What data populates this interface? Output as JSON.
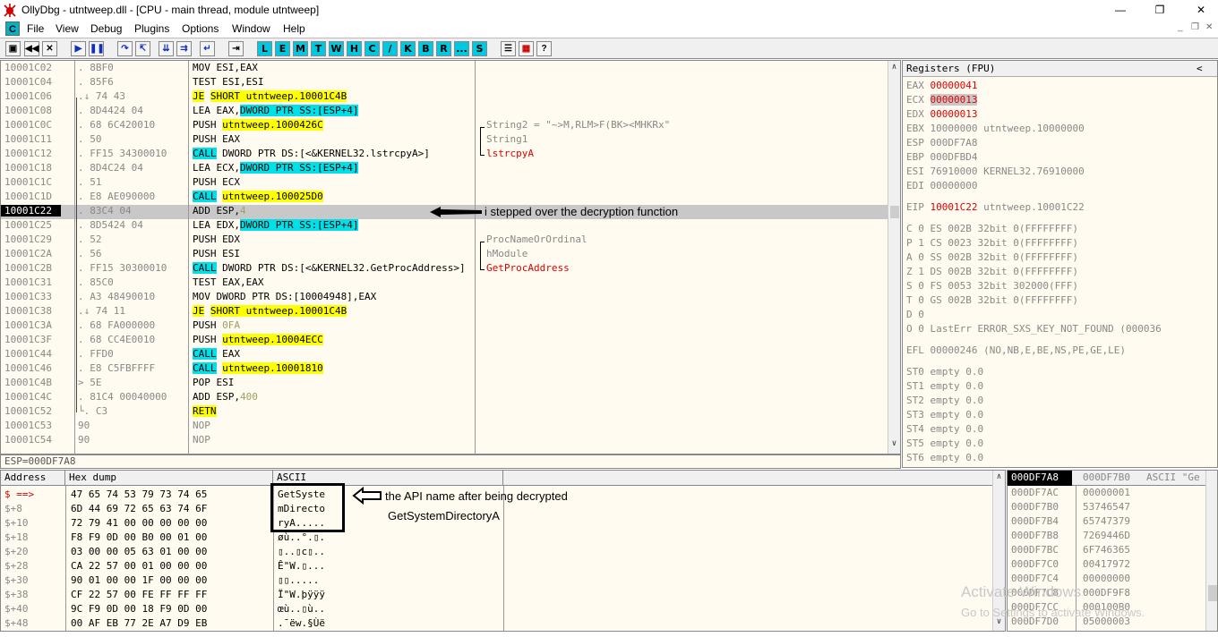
{
  "window": {
    "title": "OllyDbg - utntweep.dll - [CPU - main thread, module utntweep]",
    "controls": [
      "—",
      "❐",
      "✕"
    ]
  },
  "menu": {
    "items": [
      "File",
      "View",
      "Debug",
      "Plugins",
      "Options",
      "Window",
      "Help"
    ],
    "icon_letter": "C",
    "mdi_controls": [
      "_",
      "❐",
      "✕"
    ]
  },
  "toolbar": {
    "letters": [
      "L",
      "E",
      "M",
      "T",
      "W",
      "H",
      "C",
      "/",
      "K",
      "B",
      "R",
      "...",
      "S"
    ]
  },
  "disasm": {
    "rows": [
      {
        "addr": "10001C02",
        "hex": ". 8BF0",
        "dis": [
          {
            "t": "MOV ESI,EAX"
          }
        ],
        "com": []
      },
      {
        "addr": "10001C04",
        "hex": ". 85F6",
        "dis": [
          {
            "t": "TEST ESI,ESI"
          }
        ],
        "com": []
      },
      {
        "addr": "10001C06",
        "hex": ".↓ 74 43",
        "dis": [
          {
            "t": "JE",
            "c": "y"
          },
          {
            "t": " "
          },
          {
            "t": "SHORT utntweep.10001C4B",
            "c": "y"
          }
        ],
        "com": []
      },
      {
        "addr": "10001C08",
        "hex": ". 8D4424 04",
        "dis": [
          {
            "t": "LEA EAX,"
          },
          {
            "t": "DWORD PTR SS:[ESP+4]",
            "c": "c"
          }
        ],
        "com": []
      },
      {
        "addr": "10001C0C",
        "hex": ". 68 6C420010",
        "dis": [
          {
            "t": "PUSH "
          },
          {
            "t": "utntweep.1000426C",
            "c": "y"
          }
        ],
        "com": [
          {
            "t": "String2 = \"~>M,RLM>F(BK><MHKRx\"",
            "c": "g"
          }
        ]
      },
      {
        "addr": "10001C11",
        "hex": ". 50",
        "dis": [
          {
            "t": "PUSH EAX"
          }
        ],
        "com": [
          {
            "t": "String1",
            "c": "g"
          }
        ]
      },
      {
        "addr": "10001C12",
        "hex": ". FF15 34300010",
        "dis": [
          {
            "t": "CALL",
            "c": "c"
          },
          {
            "t": " DWORD PTR DS:[<&KERNEL32.lstrcpyA>]"
          }
        ],
        "com": [
          {
            "t": "lstrcpyA",
            "c": "r"
          }
        ]
      },
      {
        "addr": "10001C18",
        "hex": ". 8D4C24 04",
        "dis": [
          {
            "t": "LEA ECX,"
          },
          {
            "t": "DWORD PTR SS:[ESP+4]",
            "c": "c"
          }
        ],
        "com": []
      },
      {
        "addr": "10001C1C",
        "hex": ". 51",
        "dis": [
          {
            "t": "PUSH ECX"
          }
        ],
        "com": []
      },
      {
        "addr": "10001C1D",
        "hex": ". E8 AE090000",
        "dis": [
          {
            "t": "CALL",
            "c": "c"
          },
          {
            "t": " "
          },
          {
            "t": "utntweep.100025D0",
            "c": "y"
          }
        ],
        "com": []
      },
      {
        "addr": "10001C22",
        "hex": ". 83C4 04",
        "dis": [
          {
            "t": "ADD ESP,"
          },
          {
            "t": "4",
            "c": "o"
          }
        ],
        "com": [],
        "sel": true
      },
      {
        "addr": "10001C25",
        "hex": ". 8D5424 04",
        "dis": [
          {
            "t": "LEA EDX,"
          },
          {
            "t": "DWORD PTR SS:[ESP+4]",
            "c": "c"
          }
        ],
        "com": []
      },
      {
        "addr": "10001C29",
        "hex": ". 52",
        "dis": [
          {
            "t": "PUSH EDX"
          }
        ],
        "com": [
          {
            "t": "ProcNameOrOrdinal",
            "c": "g"
          }
        ]
      },
      {
        "addr": "10001C2A",
        "hex": ". 56",
        "dis": [
          {
            "t": "PUSH ESI"
          }
        ],
        "com": [
          {
            "t": "hModule",
            "c": "g"
          }
        ]
      },
      {
        "addr": "10001C2B",
        "hex": ". FF15 30300010",
        "dis": [
          {
            "t": "CALL",
            "c": "c"
          },
          {
            "t": " DWORD PTR DS:[<&KERNEL32.GetProcAddress>]"
          }
        ],
        "com": [
          {
            "t": "GetProcAddress",
            "c": "r"
          }
        ]
      },
      {
        "addr": "10001C31",
        "hex": ". 85C0",
        "dis": [
          {
            "t": "TEST EAX,EAX"
          }
        ],
        "com": []
      },
      {
        "addr": "10001C33",
        "hex": ". A3 48490010",
        "dis": [
          {
            "t": "MOV DWORD PTR DS:[10004948],EAX"
          }
        ],
        "com": []
      },
      {
        "addr": "10001C38",
        "hex": ".↓ 74 11",
        "dis": [
          {
            "t": "JE",
            "c": "y"
          },
          {
            "t": " "
          },
          {
            "t": "SHORT utntweep.10001C4B",
            "c": "y"
          }
        ],
        "com": []
      },
      {
        "addr": "10001C3A",
        "hex": ". 68 FA000000",
        "dis": [
          {
            "t": "PUSH "
          },
          {
            "t": "0FA",
            "c": "o"
          }
        ],
        "com": []
      },
      {
        "addr": "10001C3F",
        "hex": ". 68 CC4E0010",
        "dis": [
          {
            "t": "PUSH "
          },
          {
            "t": "utntweep.10004ECC",
            "c": "y"
          }
        ],
        "com": []
      },
      {
        "addr": "10001C44",
        "hex": ". FFD0",
        "dis": [
          {
            "t": "CALL",
            "c": "c"
          },
          {
            "t": " EAX"
          }
        ],
        "com": []
      },
      {
        "addr": "10001C46",
        "hex": ". E8 C5FBFFFF",
        "dis": [
          {
            "t": "CALL",
            "c": "c"
          },
          {
            "t": " "
          },
          {
            "t": "utntweep.10001810",
            "c": "y"
          }
        ],
        "com": []
      },
      {
        "addr": "10001C4B",
        "hex": "> 5E",
        "dis": [
          {
            "t": "POP ESI"
          }
        ],
        "com": []
      },
      {
        "addr": "10001C4C",
        "hex": ". 81C4 00040000",
        "dis": [
          {
            "t": "ADD ESP,"
          },
          {
            "t": "400",
            "c": "o"
          }
        ],
        "com": []
      },
      {
        "addr": "10001C52",
        "hex": "└. C3",
        "dis": [
          {
            "t": "RETN",
            "c": "ybg"
          }
        ],
        "com": []
      },
      {
        "addr": "10001C53",
        "hex": "  90",
        "dis": [
          {
            "t": "NOP",
            "c": "g"
          }
        ],
        "com": []
      },
      {
        "addr": "10001C54",
        "hex": "  90",
        "dis": [
          {
            "t": "NOP",
            "c": "g"
          }
        ],
        "com": []
      }
    ],
    "status": "ESP=000DF7A8"
  },
  "annotations": {
    "step_note": "i stepped over the decryption function",
    "api_note_1": "the API name after being decrypted",
    "api_note_2": "GetSystemDirectoryA"
  },
  "registers": {
    "title": "Registers (FPU)",
    "collapse": "<",
    "gpr": [
      {
        "name": "EAX",
        "val": "00000041",
        "c": "r"
      },
      {
        "name": "ECX",
        "val": "00000013",
        "c": "rg"
      },
      {
        "name": "EDX",
        "val": "00000013",
        "c": "r"
      },
      {
        "name": "EBX",
        "val": "10000000 utntweep.10000000"
      },
      {
        "name": "ESP",
        "val": "000DF7A8"
      },
      {
        "name": "EBP",
        "val": "000DFBD4"
      },
      {
        "name": "ESI",
        "val": "76910000 KERNEL32.76910000"
      },
      {
        "name": "EDI",
        "val": "00000000"
      }
    ],
    "eip": {
      "name": "EIP",
      "val": "10001C22",
      "rest": " utntweep.10001C22"
    },
    "flags": [
      "C 0  ES 002B 32bit 0(FFFFFFFF)",
      "P 1  CS 0023 32bit 0(FFFFFFFF)",
      "A 0  SS 002B 32bit 0(FFFFFFFF)",
      "Z 1  DS 002B 32bit 0(FFFFFFFF)",
      "S 0  FS 0053 32bit 302000(FFF)",
      "T 0  GS 002B 32bit 0(FFFFFFFF)",
      "D 0",
      "O 0  LastErr ERROR_SXS_KEY_NOT_FOUND (000036"
    ],
    "efl": "EFL 00000246 (NO,NB,E,BE,NS,PE,GE,LE)",
    "fpu": [
      "ST0 empty 0.0",
      "ST1 empty 0.0",
      "ST2 empty 0.0",
      "ST3 empty 0.0",
      "ST4 empty 0.0",
      "ST5 empty 0.0",
      "ST6 empty 0.0"
    ]
  },
  "dump": {
    "headers": [
      "Address",
      "Hex dump",
      "ASCII"
    ],
    "rows": [
      {
        "addr": "$ ==>",
        "hex": "47 65 74 53 79 73 74 65",
        "ascii": "GetSyste",
        "red": true
      },
      {
        "addr": "$+8",
        "hex": "6D 44 69 72 65 63 74 6F",
        "ascii": "mDirecto"
      },
      {
        "addr": "$+10",
        "hex": "72 79 41 00 00 00 00 00",
        "ascii": "ryA....."
      },
      {
        "addr": "$+18",
        "hex": "F8 F9 0D 00 B0 00 01 00",
        "ascii": "øù..°.▯.",
        "last_gray": true
      },
      {
        "addr": "$+20",
        "hex": "03 00 00 05 63 01 00 00",
        "ascii": "▯..▯c▯.."
      },
      {
        "addr": "$+28",
        "hex": "CA 22 57 00 01 00 00 00",
        "ascii": "Ê\"W.▯..."
      },
      {
        "addr": "$+30",
        "hex": "90 01 00 00 1F 00 00 00",
        "ascii": "▯▯....."
      },
      {
        "addr": "$+38",
        "hex": "CF 22 57 00 FE FF FF FF",
        "ascii": "Ï\"W.þÿÿÿ"
      },
      {
        "addr": "$+40",
        "hex": "9C F9 0D 00 18 F9 0D 00",
        "ascii": "œù..▯ù.."
      },
      {
        "addr": "$+48",
        "hex": "00 AF EB 77 2E A7 D9 EB",
        "ascii": ".¯ëw.§Ùë"
      }
    ]
  },
  "stack": {
    "headers": [
      "000DF7A8",
      "000DF7B0",
      "ASCII \"Ge"
    ],
    "rows": [
      {
        "addr": "000DF7AC",
        "val": "00000001"
      },
      {
        "addr": "000DF7B0",
        "val": "53746547"
      },
      {
        "addr": "000DF7B4",
        "val": "65747379"
      },
      {
        "addr": "000DF7B8",
        "val": "7269446D"
      },
      {
        "addr": "000DF7BC",
        "val": "6F746365"
      },
      {
        "addr": "000DF7C0",
        "val": "00417972"
      },
      {
        "addr": "000DF7C4",
        "val": "00000000"
      },
      {
        "addr": "000DF7C8",
        "val": "000DF9F8"
      },
      {
        "addr": "000DF7CC",
        "val": "000100B0"
      },
      {
        "addr": "000DF7D0",
        "val": "05000003"
      }
    ]
  },
  "watermark": {
    "line1": "Activate Windows",
    "line2": "Go to Settings to activate Windows."
  },
  "colors": {
    "yellow": "#ffff00",
    "cyan": "#00e0e8",
    "red": "#e00000",
    "pane_bg": "#fffbf0",
    "selection": "#c8c8c8"
  }
}
